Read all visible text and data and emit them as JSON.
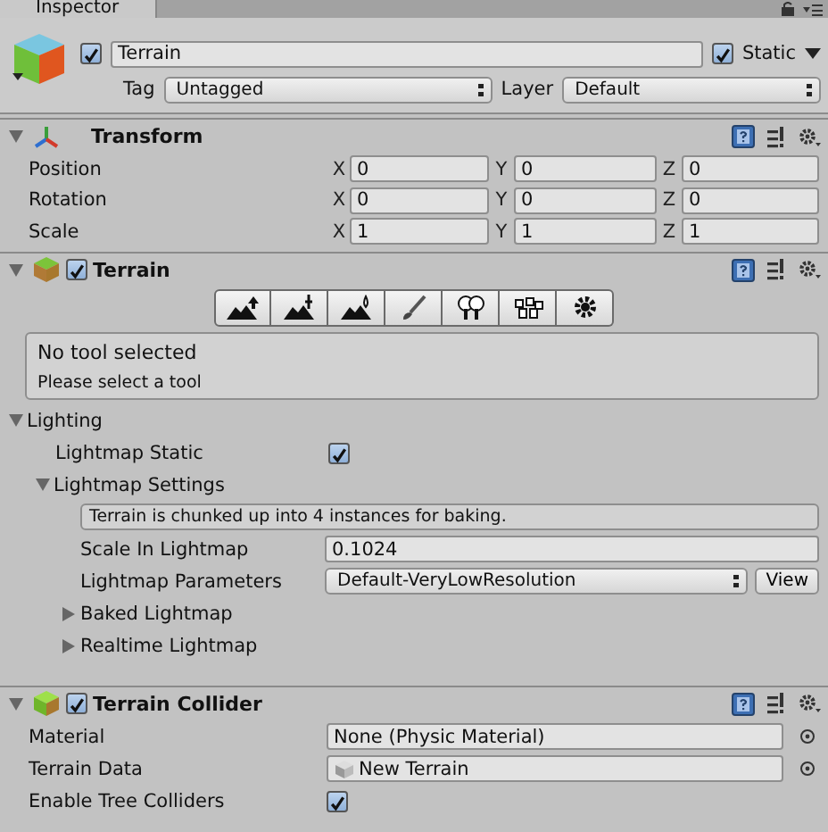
{
  "tab": {
    "title": "Inspector"
  },
  "object": {
    "active": true,
    "name": "Terrain",
    "static": true,
    "static_label": "Static",
    "tag_label": "Tag",
    "tag": "Untagged",
    "layer_label": "Layer",
    "layer": "Default"
  },
  "transform": {
    "title": "Transform",
    "expanded": true,
    "rows": [
      {
        "label": "Position",
        "fields": [
          {
            "axis": "X",
            "value": "0"
          },
          {
            "axis": "Y",
            "value": "0"
          },
          {
            "axis": "Z",
            "value": "0"
          }
        ]
      },
      {
        "label": "Rotation",
        "fields": [
          {
            "axis": "X",
            "value": "0"
          },
          {
            "axis": "Y",
            "value": "0"
          },
          {
            "axis": "Z",
            "value": "0"
          }
        ]
      },
      {
        "label": "Scale",
        "fields": [
          {
            "axis": "X",
            "value": "1"
          },
          {
            "axis": "Y",
            "value": "1"
          },
          {
            "axis": "Z",
            "value": "1"
          }
        ]
      }
    ]
  },
  "terrain": {
    "title": "Terrain",
    "enabled": true,
    "expanded": true,
    "tools": [
      {
        "kind": "raise",
        "selected": false
      },
      {
        "kind": "height",
        "selected": false
      },
      {
        "kind": "smooth",
        "selected": false
      },
      {
        "kind": "paint",
        "selected": false
      },
      {
        "kind": "trees",
        "selected": false
      },
      {
        "kind": "details",
        "selected": false
      },
      {
        "kind": "settings",
        "selected": false
      }
    ],
    "message_title": "No tool selected",
    "message": "Please select a tool",
    "lighting": {
      "title": "Lighting",
      "expanded": true,
      "static_label": "Lightmap Static",
      "static": true,
      "settings": {
        "title": "Lightmap Settings",
        "expanded": true,
        "info": "Terrain is chunked up into 4 instances for baking.",
        "scale_label": "Scale In Lightmap",
        "scale": "0.1024",
        "params_label": "Lightmap Parameters",
        "params": "Default-VeryLowResolution",
        "view_button": "View",
        "subsections": [
          {
            "title": "Baked Lightmap",
            "expanded": false
          },
          {
            "title": "Realtime Lightmap",
            "expanded": false
          }
        ]
      }
    }
  },
  "collider": {
    "title": "Terrain Collider",
    "enabled": true,
    "expanded": true,
    "rows": [
      {
        "kind": "object",
        "label": "Material",
        "value": "None (Physic Material)",
        "icon": false
      },
      {
        "kind": "object",
        "label": "Terrain Data",
        "value": "New Terrain",
        "icon": true
      },
      {
        "kind": "checkbox",
        "label": "Enable Tree Colliders",
        "checked": true
      }
    ]
  }
}
